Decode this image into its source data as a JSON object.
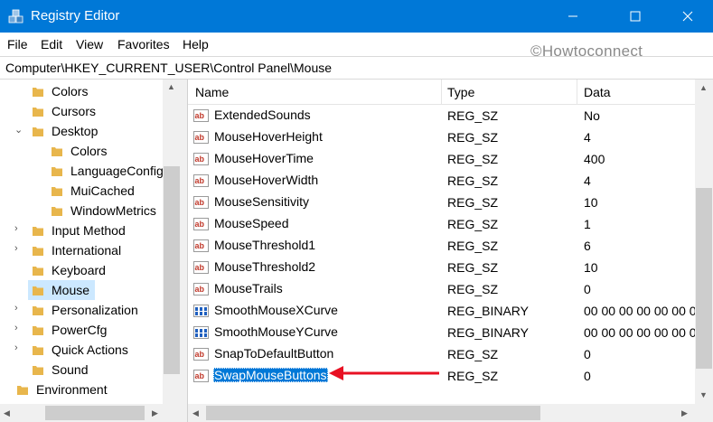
{
  "window": {
    "title": "Registry Editor",
    "minimize_glyph": "—",
    "maximize_glyph": "☐",
    "close_glyph": "✕"
  },
  "menu": {
    "items": [
      "File",
      "Edit",
      "View",
      "Favorites",
      "Help"
    ]
  },
  "watermark": "©Howtoconnect",
  "address": "Computer\\HKEY_CURRENT_USER\\Control Panel\\Mouse",
  "tree": {
    "items": [
      {
        "label": "Colors",
        "expander": "",
        "level": 1
      },
      {
        "label": "Cursors",
        "expander": "",
        "level": 1
      },
      {
        "label": "Desktop",
        "expander": "⌄",
        "level": 1
      },
      {
        "label": "Colors",
        "expander": "",
        "level": 2
      },
      {
        "label": "LanguageConfig",
        "expander": "",
        "level": 2
      },
      {
        "label": "MuiCached",
        "expander": "",
        "level": 2
      },
      {
        "label": "WindowMetrics",
        "expander": "",
        "level": 2
      },
      {
        "label": "Input Method",
        "expander": "›",
        "level": 1
      },
      {
        "label": "International",
        "expander": "›",
        "level": 1
      },
      {
        "label": "Keyboard",
        "expander": "",
        "level": 1
      },
      {
        "label": "Mouse",
        "expander": "",
        "level": 1,
        "selected": true
      },
      {
        "label": "Personalization",
        "expander": "›",
        "level": 1
      },
      {
        "label": "PowerCfg",
        "expander": "›",
        "level": 1
      },
      {
        "label": "Quick Actions",
        "expander": "›",
        "level": 1
      },
      {
        "label": "Sound",
        "expander": "",
        "level": 1
      },
      {
        "label": "Environment",
        "expander": "",
        "level": 0
      }
    ]
  },
  "list": {
    "columns": {
      "name": "Name",
      "type": "Type",
      "data": "Data"
    },
    "rows": [
      {
        "icon": "string-value-icon",
        "name": "ExtendedSounds",
        "type": "REG_SZ",
        "data": "No"
      },
      {
        "icon": "string-value-icon",
        "name": "MouseHoverHeight",
        "type": "REG_SZ",
        "data": "4"
      },
      {
        "icon": "string-value-icon",
        "name": "MouseHoverTime",
        "type": "REG_SZ",
        "data": "400"
      },
      {
        "icon": "string-value-icon",
        "name": "MouseHoverWidth",
        "type": "REG_SZ",
        "data": "4"
      },
      {
        "icon": "string-value-icon",
        "name": "MouseSensitivity",
        "type": "REG_SZ",
        "data": "10"
      },
      {
        "icon": "string-value-icon",
        "name": "MouseSpeed",
        "type": "REG_SZ",
        "data": "1"
      },
      {
        "icon": "string-value-icon",
        "name": "MouseThreshold1",
        "type": "REG_SZ",
        "data": "6"
      },
      {
        "icon": "string-value-icon",
        "name": "MouseThreshold2",
        "type": "REG_SZ",
        "data": "10"
      },
      {
        "icon": "string-value-icon",
        "name": "MouseTrails",
        "type": "REG_SZ",
        "data": "0"
      },
      {
        "icon": "binary-value-icon",
        "name": "SmoothMouseXCurve",
        "type": "REG_BINARY",
        "data": "00 00 00 00 00 00 0"
      },
      {
        "icon": "binary-value-icon",
        "name": "SmoothMouseYCurve",
        "type": "REG_BINARY",
        "data": "00 00 00 00 00 00 0"
      },
      {
        "icon": "string-value-icon",
        "name": "SnapToDefaultButton",
        "type": "REG_SZ",
        "data": "0"
      },
      {
        "icon": "string-value-icon",
        "name": "SwapMouseButtons",
        "type": "REG_SZ",
        "data": "0",
        "selected": true
      }
    ]
  },
  "colors": {
    "titlebar": "#0078d7",
    "selection": "#0078d7",
    "tree_selection": "#cce8ff",
    "annotation_arrow": "#e81123",
    "folder": "#e8b64c"
  },
  "scroll": {
    "up": "▲",
    "down": "▼",
    "left": "◀",
    "right": "▶"
  }
}
